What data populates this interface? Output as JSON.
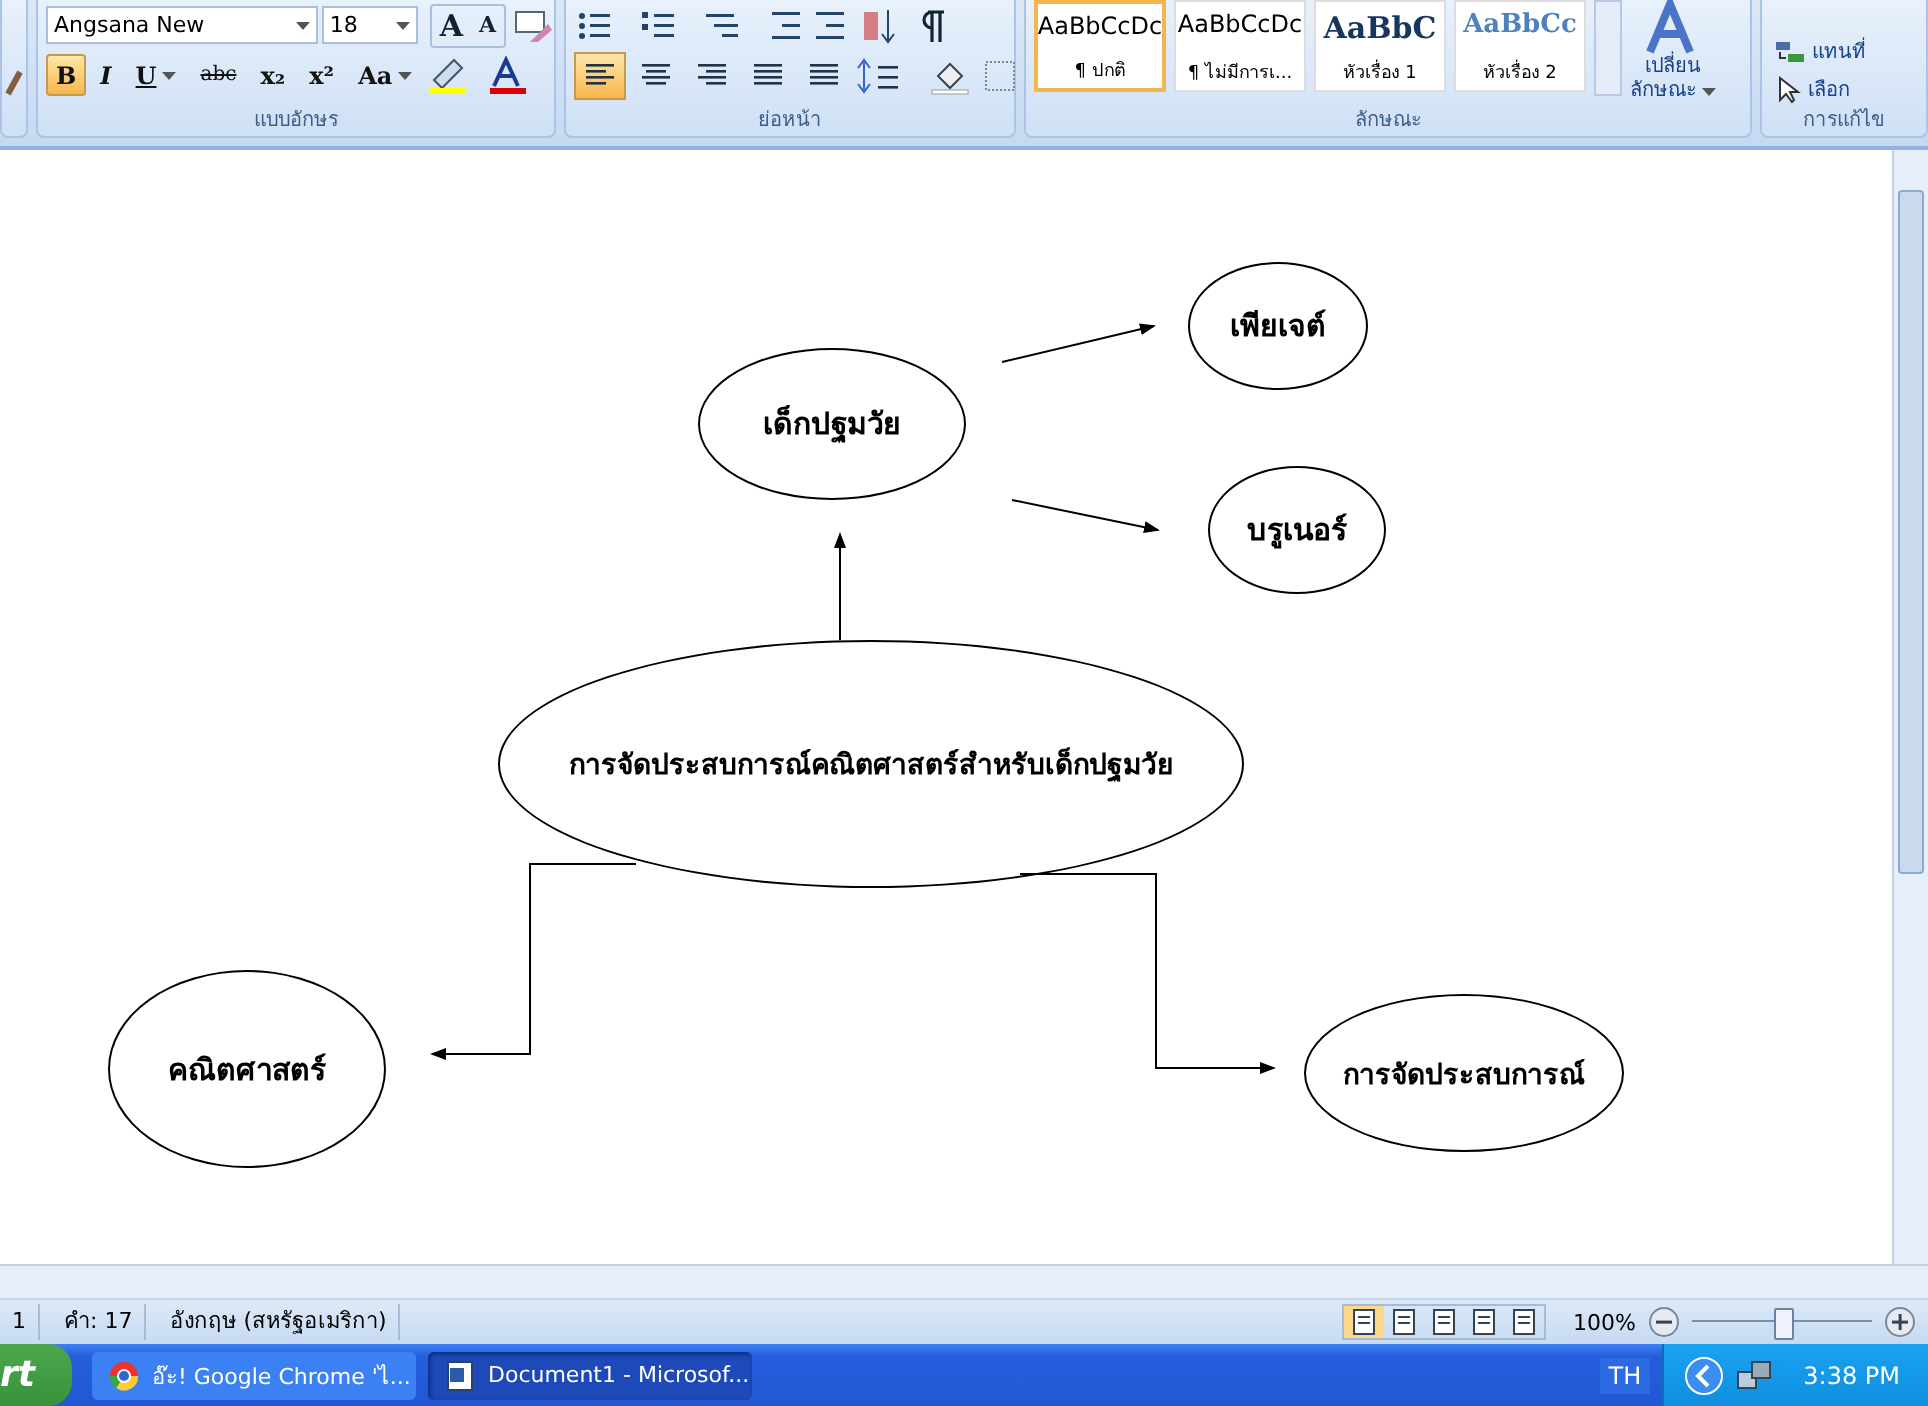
{
  "ribbon": {
    "font": {
      "name": "Angsana New",
      "size": "18",
      "label": "แบบอักษร",
      "grow": [
        "A",
        "A"
      ],
      "buttons": [
        {
          "label": "B",
          "selected": true,
          "kind": "bold",
          "dropdown": false
        },
        {
          "label": "I",
          "selected": false,
          "kind": "italic",
          "dropdown": false
        },
        {
          "label": "U",
          "selected": false,
          "kind": "underline",
          "dropdown": true
        },
        {
          "label": "abc",
          "selected": false,
          "kind": "strike",
          "dropdown": false
        },
        {
          "label": "x₂",
          "selected": false,
          "kind": "plain",
          "dropdown": false
        },
        {
          "label": "x²",
          "selected": false,
          "kind": "plain",
          "dropdown": false
        },
        {
          "label": "Aa",
          "selected": false,
          "kind": "plain",
          "dropdown": true
        }
      ]
    },
    "paragraph": {
      "label": "ย่อหน้า",
      "align": [
        {
          "selected": true
        },
        {
          "selected": false
        },
        {
          "selected": false
        },
        {
          "selected": false
        },
        {
          "selected": false
        }
      ]
    },
    "styles": {
      "label": "ลักษณะ",
      "items": [
        {
          "sample": "AaBbCcDc",
          "name": "¶ ปกติ",
          "kind": "normal",
          "selected": true
        },
        {
          "sample": "AaBbCcDc",
          "name": "¶ ไม่มีการเ...",
          "kind": "normal",
          "selected": false
        },
        {
          "sample": "AaBbC",
          "name": "หัวเรื่อง 1",
          "kind": "heading1",
          "selected": false
        },
        {
          "sample": "AaBbCc",
          "name": "หัวเรื่อง 2",
          "kind": "heading2",
          "selected": false
        }
      ],
      "change": [
        "เปลี่ยน",
        "ลักษณะ"
      ]
    },
    "editing": {
      "label": "การแก้ไข",
      "items": [
        {
          "label": "แทนที่",
          "kind": "replace"
        },
        {
          "label": "เลือก",
          "kind": "select"
        }
      ]
    }
  },
  "diagram": {
    "center": "การจัดประสบการณ์คณิตศาสตร์สำหรับเด็กปฐมวัย",
    "child": "เด็กปฐมวัย",
    "theories": [
      "เพียเจต์",
      "บรูเนอร์"
    ],
    "left": "คณิตศาสตร์",
    "right": "การจัดประสบการณ์"
  },
  "status_bar": {
    "page": "1",
    "words": "คำ: 17",
    "language": "อังกฤษ (สหรัฐอเมริกา)",
    "views": [
      {
        "selected": true
      },
      {
        "selected": false
      },
      {
        "selected": false
      },
      {
        "selected": false
      },
      {
        "selected": false
      }
    ],
    "zoom": "100%",
    "zoom_slider": {
      "level": 0.5
    }
  },
  "taskbar": {
    "start": "rt",
    "tasks": [
      {
        "label": "อ๊ะ! Google Chrome 'ไ...",
        "kind": "chrome",
        "selected": false
      },
      {
        "label": "Document1 - Microsof...",
        "kind": "word",
        "selected": true
      }
    ],
    "language": "TH",
    "clock": "3:38 PM"
  }
}
